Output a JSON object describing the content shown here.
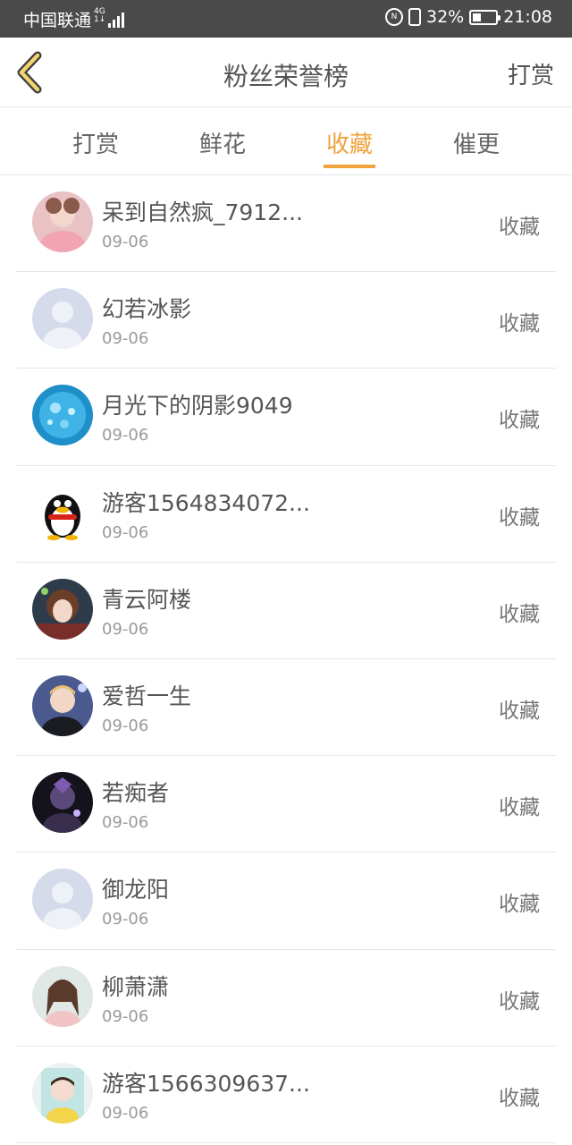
{
  "status_bar": {
    "carrier": "中国联通",
    "network_top": "4G",
    "network_bottom": "1↓",
    "battery": "32%",
    "time": "21:08"
  },
  "header": {
    "title": "粉丝荣誉榜",
    "action_label": "打赏",
    "back_icon": "chevron-left-icon"
  },
  "tabs": [
    {
      "label": "打赏",
      "active": false
    },
    {
      "label": "鲜花",
      "active": false
    },
    {
      "label": "收藏",
      "active": true
    },
    {
      "label": "催更",
      "active": false
    }
  ],
  "colors": {
    "accent": "#f0a23b",
    "status_bar": "#4a4a4a",
    "text": "#555555",
    "muted": "#9a9a9a"
  },
  "fans": [
    {
      "name": "呆到自然疯_7912...",
      "date": "09-06",
      "action": "收藏",
      "avatar": "photo-girl-pink"
    },
    {
      "name": "幻若冰影",
      "date": "09-06",
      "action": "收藏",
      "avatar": "default-avatar"
    },
    {
      "name": "月光下的阴影9049",
      "date": "09-06",
      "action": "收藏",
      "avatar": "blue-sparkle"
    },
    {
      "name": "游客1564834072...",
      "date": "09-06",
      "action": "收藏",
      "avatar": "qq-penguin"
    },
    {
      "name": "青云阿楼",
      "date": "09-06",
      "action": "收藏",
      "avatar": "anime-girl"
    },
    {
      "name": "爱哲一生",
      "date": "09-06",
      "action": "收藏",
      "avatar": "photo-boy"
    },
    {
      "name": "若痴者",
      "date": "09-06",
      "action": "收藏",
      "avatar": "dark-character"
    },
    {
      "name": "御龙阳",
      "date": "09-06",
      "action": "收藏",
      "avatar": "default-avatar"
    },
    {
      "name": "柳萧潇",
      "date": "09-06",
      "action": "收藏",
      "avatar": "photo-girl-light"
    },
    {
      "name": "游客1566309637...",
      "date": "09-06",
      "action": "收藏",
      "avatar": "photo-girl-child"
    }
  ]
}
